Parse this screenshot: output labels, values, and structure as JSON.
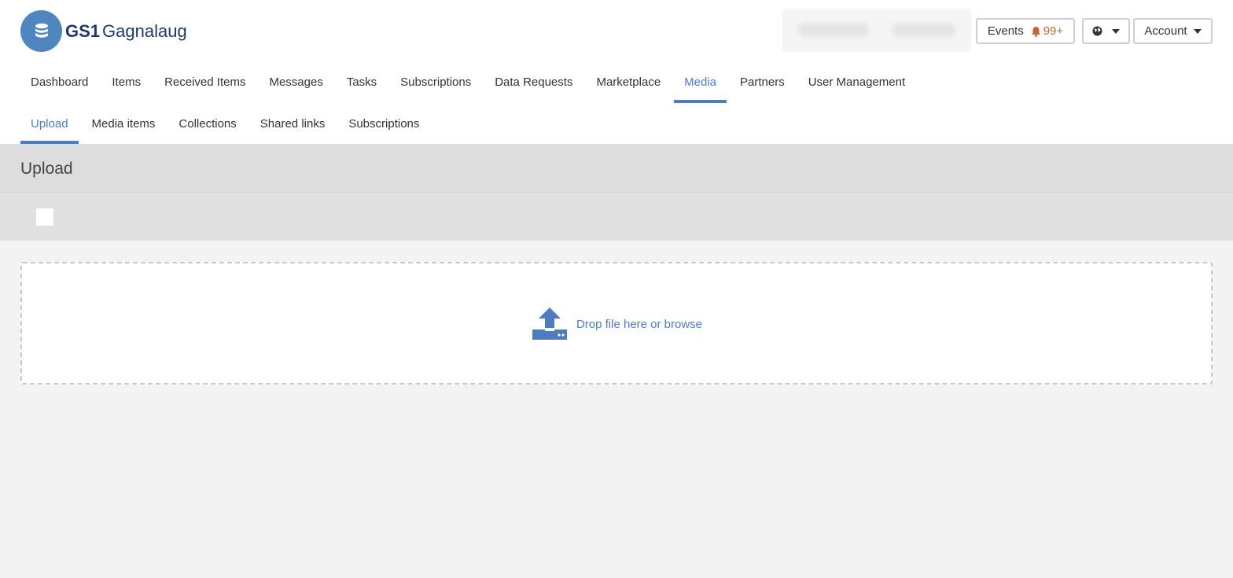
{
  "brand": {
    "gs1": "GS1",
    "name": "Gagnalaug"
  },
  "header": {
    "events_label": "Events",
    "events_count": "99+",
    "account_label": "Account"
  },
  "main_nav": [
    {
      "label": "Dashboard"
    },
    {
      "label": "Items"
    },
    {
      "label": "Received Items"
    },
    {
      "label": "Messages"
    },
    {
      "label": "Tasks"
    },
    {
      "label": "Subscriptions"
    },
    {
      "label": "Data Requests"
    },
    {
      "label": "Marketplace"
    },
    {
      "label": "Media",
      "active": true
    },
    {
      "label": "Partners"
    },
    {
      "label": "User Management"
    }
  ],
  "sub_nav": [
    {
      "label": "Upload",
      "active": true
    },
    {
      "label": "Media items"
    },
    {
      "label": "Collections"
    },
    {
      "label": "Shared links"
    },
    {
      "label": "Subscriptions"
    }
  ],
  "page": {
    "title": "Upload",
    "dropzone_text": "Drop file here or browse"
  },
  "colors": {
    "accent": "#4f7cc0",
    "brand_circle": "#4f86bf",
    "notification": "#b86a3a"
  },
  "icons": {
    "logo": "database-icon",
    "notification": "bell-icon",
    "language": "globe-icon",
    "upload": "upload-tray-icon"
  }
}
